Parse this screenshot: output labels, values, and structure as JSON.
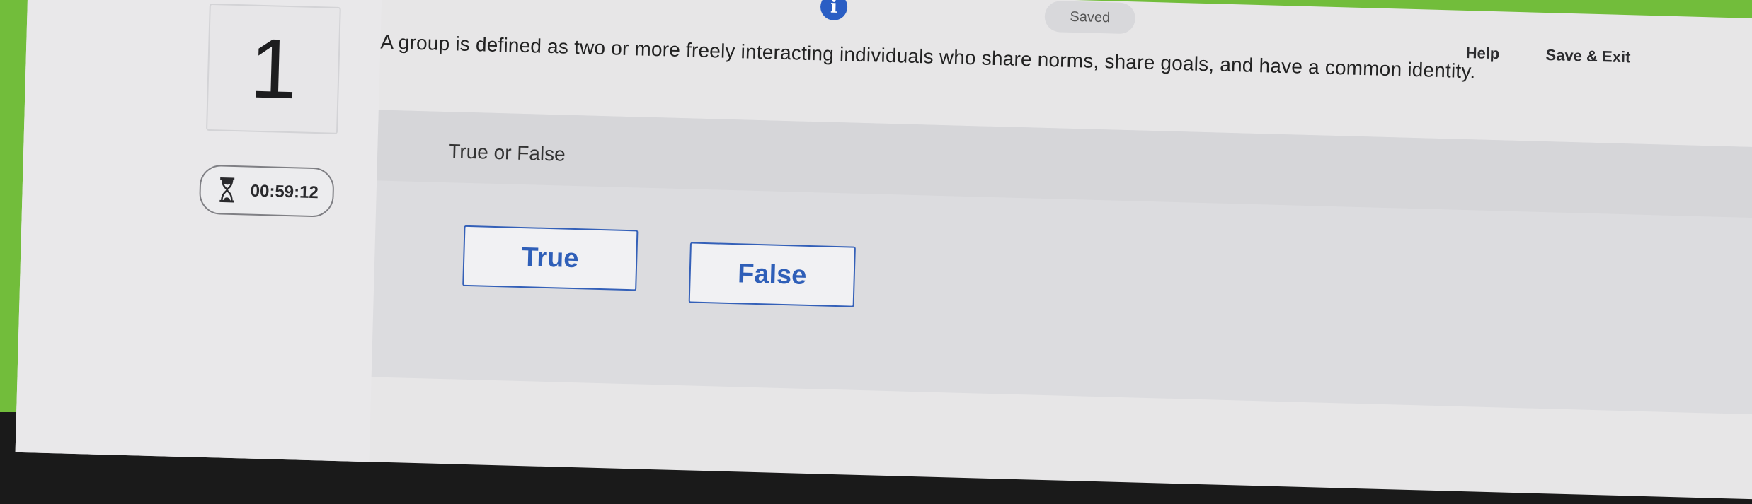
{
  "header": {
    "saved_label": "Saved",
    "help_label": "Help",
    "save_exit_label": "Save & Exit",
    "info_icon": "i"
  },
  "question": {
    "number": "1",
    "text": "A group is defined as two or more freely interacting individuals who share norms, share goals, and have a common identity.",
    "type_label": "True or False"
  },
  "timer": {
    "value": "00:59:12",
    "icon": "hourglass-icon"
  },
  "options": [
    {
      "label": "True"
    },
    {
      "label": "False"
    }
  ],
  "colors": {
    "accent": "#2f5fb8",
    "bezel_green": "#72bd3b",
    "page_bg": "#e7e6e7"
  }
}
